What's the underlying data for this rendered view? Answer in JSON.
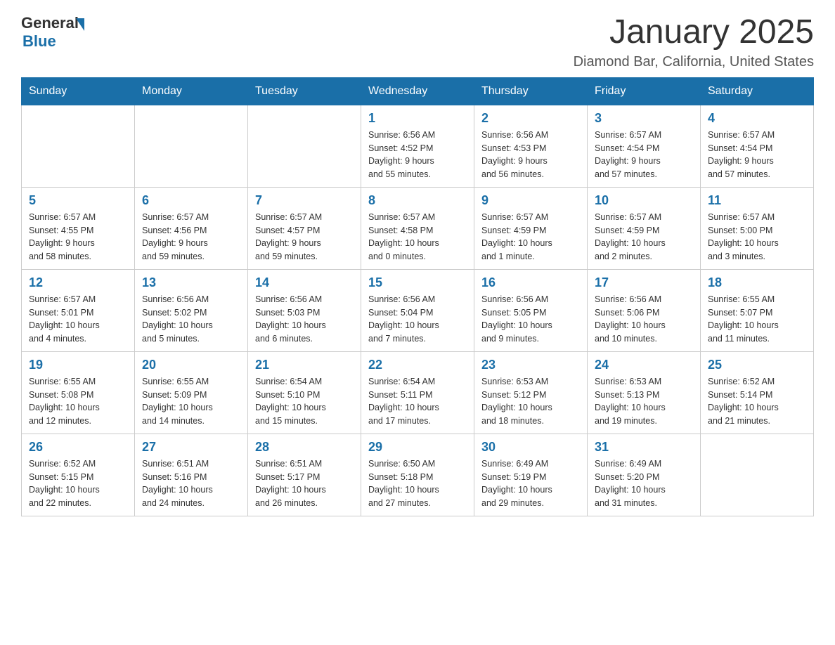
{
  "header": {
    "logo": {
      "general": "General",
      "blue": "Blue"
    },
    "month_title": "January 2025",
    "location": "Diamond Bar, California, United States"
  },
  "weekdays": [
    "Sunday",
    "Monday",
    "Tuesday",
    "Wednesday",
    "Thursday",
    "Friday",
    "Saturday"
  ],
  "weeks": [
    [
      {
        "day": "",
        "info": ""
      },
      {
        "day": "",
        "info": ""
      },
      {
        "day": "",
        "info": ""
      },
      {
        "day": "1",
        "info": "Sunrise: 6:56 AM\nSunset: 4:52 PM\nDaylight: 9 hours\nand 55 minutes."
      },
      {
        "day": "2",
        "info": "Sunrise: 6:56 AM\nSunset: 4:53 PM\nDaylight: 9 hours\nand 56 minutes."
      },
      {
        "day": "3",
        "info": "Sunrise: 6:57 AM\nSunset: 4:54 PM\nDaylight: 9 hours\nand 57 minutes."
      },
      {
        "day": "4",
        "info": "Sunrise: 6:57 AM\nSunset: 4:54 PM\nDaylight: 9 hours\nand 57 minutes."
      }
    ],
    [
      {
        "day": "5",
        "info": "Sunrise: 6:57 AM\nSunset: 4:55 PM\nDaylight: 9 hours\nand 58 minutes."
      },
      {
        "day": "6",
        "info": "Sunrise: 6:57 AM\nSunset: 4:56 PM\nDaylight: 9 hours\nand 59 minutes."
      },
      {
        "day": "7",
        "info": "Sunrise: 6:57 AM\nSunset: 4:57 PM\nDaylight: 9 hours\nand 59 minutes."
      },
      {
        "day": "8",
        "info": "Sunrise: 6:57 AM\nSunset: 4:58 PM\nDaylight: 10 hours\nand 0 minutes."
      },
      {
        "day": "9",
        "info": "Sunrise: 6:57 AM\nSunset: 4:59 PM\nDaylight: 10 hours\nand 1 minute."
      },
      {
        "day": "10",
        "info": "Sunrise: 6:57 AM\nSunset: 4:59 PM\nDaylight: 10 hours\nand 2 minutes."
      },
      {
        "day": "11",
        "info": "Sunrise: 6:57 AM\nSunset: 5:00 PM\nDaylight: 10 hours\nand 3 minutes."
      }
    ],
    [
      {
        "day": "12",
        "info": "Sunrise: 6:57 AM\nSunset: 5:01 PM\nDaylight: 10 hours\nand 4 minutes."
      },
      {
        "day": "13",
        "info": "Sunrise: 6:56 AM\nSunset: 5:02 PM\nDaylight: 10 hours\nand 5 minutes."
      },
      {
        "day": "14",
        "info": "Sunrise: 6:56 AM\nSunset: 5:03 PM\nDaylight: 10 hours\nand 6 minutes."
      },
      {
        "day": "15",
        "info": "Sunrise: 6:56 AM\nSunset: 5:04 PM\nDaylight: 10 hours\nand 7 minutes."
      },
      {
        "day": "16",
        "info": "Sunrise: 6:56 AM\nSunset: 5:05 PM\nDaylight: 10 hours\nand 9 minutes."
      },
      {
        "day": "17",
        "info": "Sunrise: 6:56 AM\nSunset: 5:06 PM\nDaylight: 10 hours\nand 10 minutes."
      },
      {
        "day": "18",
        "info": "Sunrise: 6:55 AM\nSunset: 5:07 PM\nDaylight: 10 hours\nand 11 minutes."
      }
    ],
    [
      {
        "day": "19",
        "info": "Sunrise: 6:55 AM\nSunset: 5:08 PM\nDaylight: 10 hours\nand 12 minutes."
      },
      {
        "day": "20",
        "info": "Sunrise: 6:55 AM\nSunset: 5:09 PM\nDaylight: 10 hours\nand 14 minutes."
      },
      {
        "day": "21",
        "info": "Sunrise: 6:54 AM\nSunset: 5:10 PM\nDaylight: 10 hours\nand 15 minutes."
      },
      {
        "day": "22",
        "info": "Sunrise: 6:54 AM\nSunset: 5:11 PM\nDaylight: 10 hours\nand 17 minutes."
      },
      {
        "day": "23",
        "info": "Sunrise: 6:53 AM\nSunset: 5:12 PM\nDaylight: 10 hours\nand 18 minutes."
      },
      {
        "day": "24",
        "info": "Sunrise: 6:53 AM\nSunset: 5:13 PM\nDaylight: 10 hours\nand 19 minutes."
      },
      {
        "day": "25",
        "info": "Sunrise: 6:52 AM\nSunset: 5:14 PM\nDaylight: 10 hours\nand 21 minutes."
      }
    ],
    [
      {
        "day": "26",
        "info": "Sunrise: 6:52 AM\nSunset: 5:15 PM\nDaylight: 10 hours\nand 22 minutes."
      },
      {
        "day": "27",
        "info": "Sunrise: 6:51 AM\nSunset: 5:16 PM\nDaylight: 10 hours\nand 24 minutes."
      },
      {
        "day": "28",
        "info": "Sunrise: 6:51 AM\nSunset: 5:17 PM\nDaylight: 10 hours\nand 26 minutes."
      },
      {
        "day": "29",
        "info": "Sunrise: 6:50 AM\nSunset: 5:18 PM\nDaylight: 10 hours\nand 27 minutes."
      },
      {
        "day": "30",
        "info": "Sunrise: 6:49 AM\nSunset: 5:19 PM\nDaylight: 10 hours\nand 29 minutes."
      },
      {
        "day": "31",
        "info": "Sunrise: 6:49 AM\nSunset: 5:20 PM\nDaylight: 10 hours\nand 31 minutes."
      },
      {
        "day": "",
        "info": ""
      }
    ]
  ]
}
